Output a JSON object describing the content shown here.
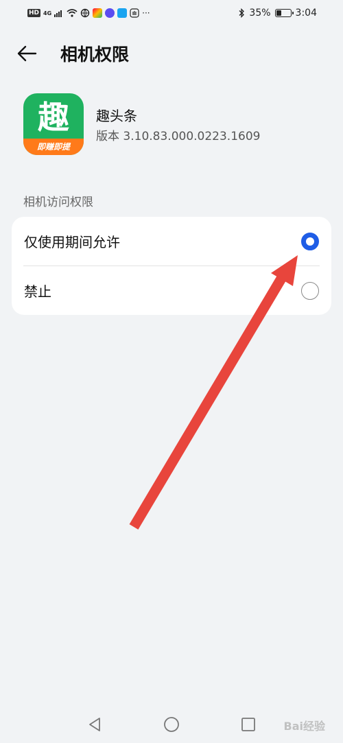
{
  "status_bar": {
    "hd": "HD",
    "net": "4G",
    "battery": "35%",
    "battery_level": 0.35,
    "time": "3:04",
    "more": "···"
  },
  "header": {
    "title": "相机权限",
    "back_icon": "arrow-left-icon"
  },
  "app": {
    "name": "趣头条",
    "version": "版本 3.10.83.000.0223.1609",
    "icon_char": "趣",
    "icon_banner": "即赚即提",
    "icon_color": "#1fb25f",
    "banner_color": "#ff7a1a"
  },
  "section": {
    "label": "相机访问权限",
    "options": [
      {
        "label": "仅使用期间允许",
        "selected": true
      },
      {
        "label": "禁止",
        "selected": false
      }
    ]
  },
  "colors": {
    "accent": "#1f5de6",
    "annotation_arrow": "#e8453c",
    "background": "#f1f3f5"
  },
  "nav": {
    "back": "triangle-back-icon",
    "home": "circle-home-icon",
    "recents": "square-recents-icon"
  },
  "watermark": "Bai经验"
}
